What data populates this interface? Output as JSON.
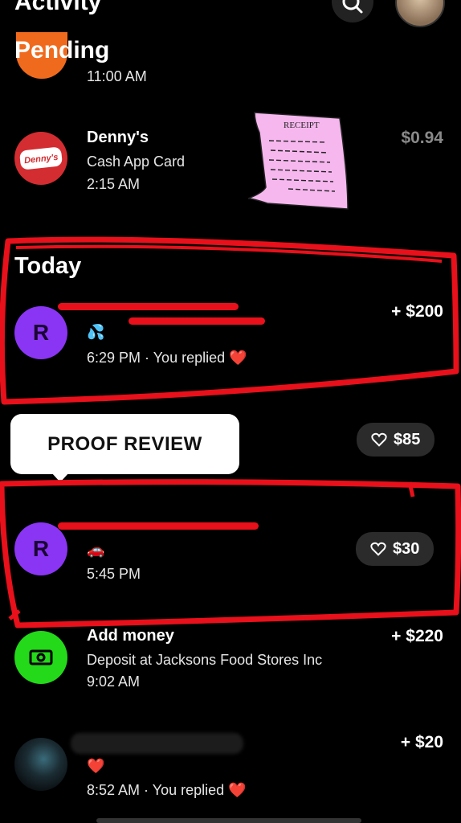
{
  "header": {
    "title": "Activity"
  },
  "pending": {
    "title": "Pending",
    "row0": {
      "time": "11:00 AM"
    },
    "row1": {
      "name": "Denny's",
      "sub": "Cash App Card",
      "time": "2:15 AM",
      "amount": "$0.94",
      "logo_text": "Denny's"
    }
  },
  "receipt": {
    "label": "RECEIPT",
    "color": "#f6b7ee"
  },
  "today": {
    "title": "Today",
    "row1": {
      "avatar": "R",
      "note": "💦",
      "time": "6:29 PM · You replied ❤️",
      "amount": "+ $200"
    },
    "tooltip": "PROOF REVIEW",
    "row2_pill": "$85",
    "row3": {
      "avatar": "R",
      "note": "🚗",
      "time": "5:45 PM",
      "amount": "$30"
    },
    "row4": {
      "name": "Add money",
      "sub": "Deposit at Jacksons Food Stores Inc",
      "time": "9:02 AM",
      "amount": "+ $220"
    },
    "row5": {
      "note": "❤️",
      "time": "8:52 AM · You replied ❤️",
      "amount": "+ $20"
    }
  },
  "colors": {
    "red": "#e8101a",
    "purple": "#8a35f4",
    "green": "#23d91a",
    "dennys": "#d32d31"
  }
}
